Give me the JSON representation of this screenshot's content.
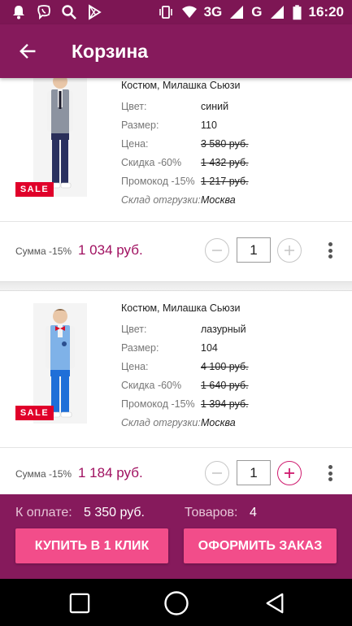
{
  "status_bar": {
    "network": "3G",
    "network2": "G",
    "time": "16:20"
  },
  "header": {
    "title": "Корзина"
  },
  "labels": {
    "color": "Цвет:",
    "size": "Размер:",
    "price": "Цена:",
    "discount": "Скидка -60%",
    "promo": "Промокод -15%",
    "warehouse": "Склад отгрузки:",
    "sum": "Сумма -15%"
  },
  "items": [
    {
      "name": "Костюм, Милашка Сьюзи",
      "badge": "SALE",
      "color": "синий",
      "size": "110",
      "price": "3 580 руб.",
      "discount_price": "1 432 руб.",
      "promo_price": "1 217 руб.",
      "warehouse": "Москва",
      "sum": "1 034 руб.",
      "quantity": "1",
      "vest_color": "#8c93a0",
      "tie_color": "#1a1a2a"
    },
    {
      "name": "Костюм, Милашка Сьюзи",
      "badge": "SALE",
      "color": "лазурный",
      "size": "104",
      "price": "4 100 руб.",
      "discount_price": "1 640 руб.",
      "promo_price": "1 394 руб.",
      "warehouse": "Москва",
      "sum": "1 184 руб.",
      "quantity": "1",
      "vest_color": "#7fb2e8",
      "tie_color": "#d8102a"
    }
  ],
  "order": {
    "total_label": "К оплате:",
    "total_value": "5 350 руб.",
    "count_label": "Товаров:",
    "count_value": "4",
    "buy_one_click": "КУПИТЬ В 1 КЛИК",
    "checkout": "ОФОРМИТЬ ЗАКАЗ"
  },
  "colors": {
    "status_bar": "#7d1654",
    "app_bar": "#861a5c",
    "accent_price": "#a01060",
    "button": "#f24d8a",
    "sale_badge": "#e0002a"
  },
  "icons": {
    "status_left": [
      "notification-bell-icon",
      "viber-icon",
      "search-icon",
      "play-store-icon"
    ],
    "status_right": [
      "vibrate-icon",
      "wifi-icon",
      "signal-icon",
      "battery-icon"
    ],
    "back": "arrow-left-icon",
    "qty_minus": "minus-circle-icon",
    "qty_plus": "plus-circle-icon",
    "more": "more-vert-icon",
    "nav": [
      "square-icon",
      "circle-icon",
      "triangle-back-icon"
    ]
  }
}
